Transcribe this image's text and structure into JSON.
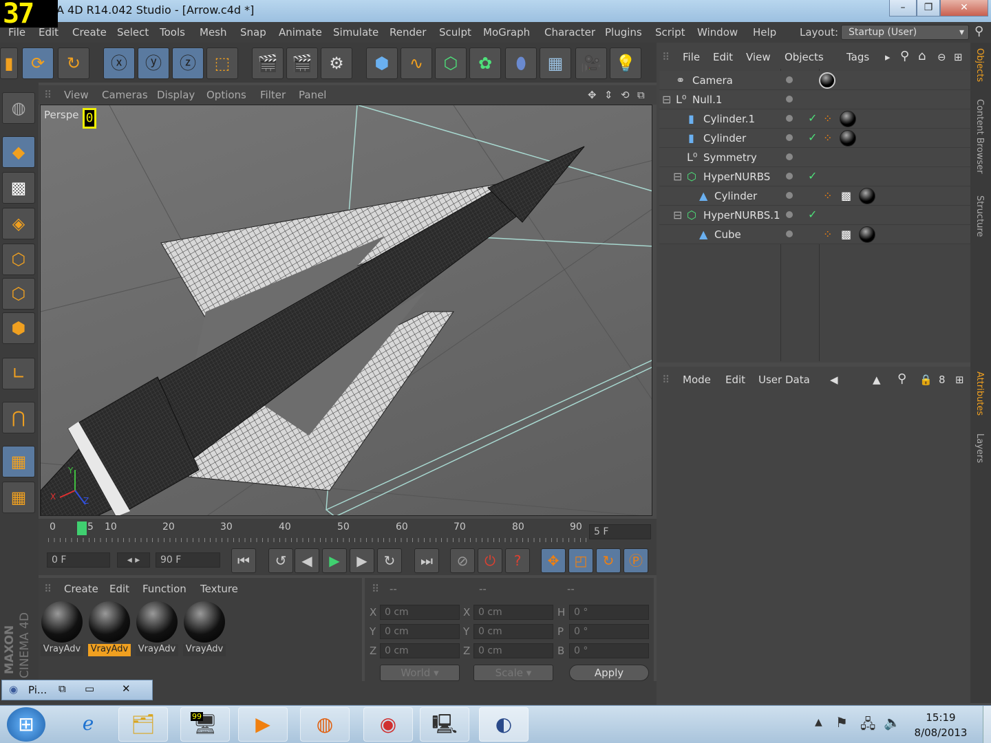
{
  "window": {
    "title": "A 4D R14.042 Studio - [Arrow.c4d *]",
    "overlay_number": "37"
  },
  "menu": [
    "File",
    "Edit",
    "Create",
    "Select",
    "Tools",
    "Mesh",
    "Snap",
    "Animate",
    "Simulate",
    "Render",
    "Sculpt",
    "MoGraph",
    "Character",
    "Plugins",
    "Script",
    "Window",
    "Help"
  ],
  "layout": {
    "label": "Layout:",
    "value": "Startup (User)"
  },
  "viewport": {
    "menu": [
      "View",
      "Cameras",
      "Display",
      "Options",
      "Filter",
      "Panel"
    ],
    "label": "Perspe",
    "cursor_char": "0",
    "axis": {
      "x": "X",
      "y": "Y",
      "z": "Z"
    }
  },
  "timeline": {
    "ticks": [
      "0",
      "5",
      "10",
      "20",
      "30",
      "40",
      "50",
      "60",
      "70",
      "80",
      "90"
    ],
    "end_field": "5 F",
    "current_frame": 5
  },
  "transport": {
    "start": "0 F",
    "end": "90 F"
  },
  "materials": {
    "menu": [
      "Create",
      "Edit",
      "Function",
      "Texture"
    ],
    "items": [
      "VrayAdv",
      "VrayAdv",
      "VrayAdv",
      "VrayAdv"
    ],
    "selected_index": 1
  },
  "coords": {
    "headers": [
      "--",
      "--",
      "--"
    ],
    "rows": [
      {
        "a": "X",
        "av": "0 cm",
        "b": "X",
        "bv": "0 cm",
        "c": "H",
        "cv": "0 °"
      },
      {
        "a": "Y",
        "av": "0 cm",
        "b": "Y",
        "bv": "0 cm",
        "c": "P",
        "cv": "0 °"
      },
      {
        "a": "Z",
        "av": "0 cm",
        "b": "Z",
        "bv": "0 cm",
        "c": "B",
        "cv": "0 °"
      }
    ],
    "world": "World",
    "scale": "Scale",
    "apply": "Apply"
  },
  "objects": {
    "menu": [
      "File",
      "Edit",
      "View",
      "Objects",
      "Tags"
    ],
    "rows": [
      {
        "name": "Camera"
      },
      {
        "name": "Null.1"
      },
      {
        "name": "Cylinder.1"
      },
      {
        "name": "Cylinder"
      },
      {
        "name": "Symmetry"
      },
      {
        "name": "HyperNURBS"
      },
      {
        "name": "Cylinder"
      },
      {
        "name": "HyperNURBS.1"
      },
      {
        "name": "Cube"
      }
    ]
  },
  "attributes": {
    "menu": [
      "Mode",
      "Edit",
      "User Data"
    ]
  },
  "sidetabs": [
    "Objects",
    "Content Browser",
    "Structure",
    "Attributes",
    "Layers"
  ],
  "brand": {
    "maxon": "MAXON",
    "cinema": "CINEMA 4D"
  },
  "taskwin": {
    "label": "Pi..."
  },
  "taskbar": {
    "time": "15:19",
    "date": "8/08/2013",
    "badge": "99"
  },
  "colors": {
    "accent": "#f0a020",
    "selection": "#5a7aa0",
    "bg": "#4a4a4a"
  }
}
